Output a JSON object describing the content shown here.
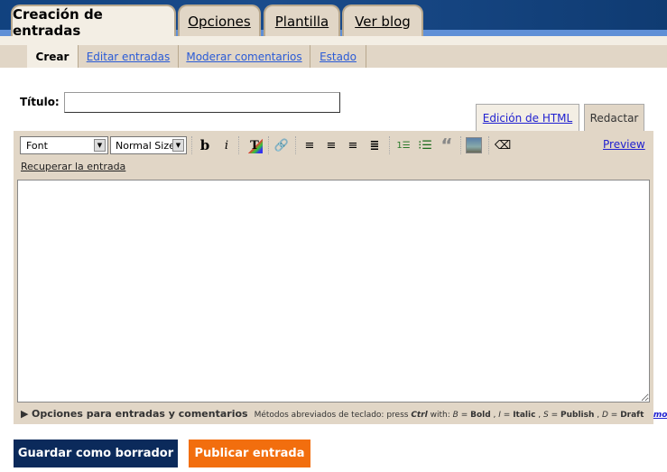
{
  "main_tabs": [
    {
      "label": "Creación de entradas"
    },
    {
      "label": "Opciones"
    },
    {
      "label": "Plantilla"
    },
    {
      "label": "Ver blog"
    }
  ],
  "sub_tabs": [
    {
      "label": "Crear"
    },
    {
      "label": "Editar entradas"
    },
    {
      "label": "Moderar comentarios"
    },
    {
      "label": "Estado"
    }
  ],
  "title_label": "Título:",
  "title_value": "",
  "mode_tabs": [
    {
      "label": "Edición de HTML"
    },
    {
      "label": "Redactar"
    }
  ],
  "toolbar": {
    "font": "Font",
    "size": "Normal Size",
    "preview": "Preview",
    "recover": "Recuperar la entrada",
    "icons": [
      "bold-icon",
      "italic-icon",
      "text-color-icon",
      "link-icon",
      "align-left-icon",
      "align-center-icon",
      "align-right-icon",
      "justify-icon",
      "numbered-list-icon",
      "bullet-list-icon",
      "blockquote-icon",
      "image-icon",
      "eraser-icon"
    ]
  },
  "footer": {
    "options": "Opciones para entradas y comentarios",
    "shortcuts_prefix": "Métodos abreviados de teclado: press",
    "ctrl": "Ctrl",
    "with": "with:",
    "b": "B",
    "bold": "Bold",
    "i": "I",
    "italic": "Italic",
    "s": "S",
    "publish": "Publish",
    "d": "D",
    "draft": "Draft",
    "more": "more »"
  },
  "buttons": {
    "save": "Guardar como borrador",
    "publish": "Publicar entrada"
  },
  "colors": {
    "banner": "#17407a",
    "tan": "#e1d6c6",
    "cream": "#f3eee4",
    "save": "#0b2a5b",
    "publish": "#f26e0e"
  }
}
